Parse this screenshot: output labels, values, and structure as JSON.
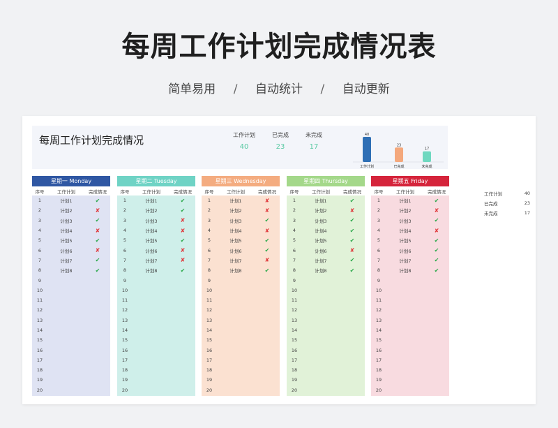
{
  "header": {
    "title": "每周工作计划完成情况表",
    "tags": [
      "简单易用",
      "自动统计",
      "自动更新"
    ],
    "separator": "/"
  },
  "summary": {
    "title": "每周工作计划完成情况",
    "stats": [
      {
        "label": "工作计划",
        "value": "40"
      },
      {
        "label": "已完成",
        "value": "23"
      },
      {
        "label": "未完成",
        "value": "17"
      }
    ]
  },
  "chart_data": {
    "type": "bar",
    "categories": [
      "工作计划",
      "已完成",
      "未完成"
    ],
    "values": [
      40,
      23,
      17
    ],
    "colors": [
      "#2e6fb5",
      "#f4a87c",
      "#6fd8c0"
    ],
    "ylim": [
      0,
      40
    ]
  },
  "columns": {
    "no": "序号",
    "plan": "工作计划",
    "status": "完成情况"
  },
  "status_icons": {
    "done": "✔",
    "not_done": "✘"
  },
  "days": [
    {
      "name": "星期一 Monday",
      "header_color": "#2f57a3",
      "body_color": "#dfe3f3",
      "plans": [
        "计划1",
        "计划2",
        "计划3",
        "计划4",
        "计划5",
        "计划6",
        "计划7",
        "计划8"
      ],
      "status": [
        1,
        0,
        1,
        0,
        1,
        0,
        1,
        1
      ]
    },
    {
      "name": "星期二 Tuesday",
      "header_color": "#6fd3c5",
      "body_color": "#cfefea",
      "plans": [
        "计划1",
        "计划2",
        "计划3",
        "计划4",
        "计划5",
        "计划6",
        "计划7",
        "计划8"
      ],
      "status": [
        1,
        1,
        0,
        0,
        1,
        0,
        0,
        1
      ]
    },
    {
      "name": "星期三 Wednesday",
      "header_color": "#f4ac80",
      "body_color": "#fbe1d1",
      "plans": [
        "计划1",
        "计划2",
        "计划3",
        "计划4",
        "计划5",
        "计划6",
        "计划7",
        "计划8"
      ],
      "status": [
        0,
        0,
        1,
        0,
        1,
        1,
        0,
        1
      ]
    },
    {
      "name": "星期四 Thursday",
      "header_color": "#a4d88a",
      "body_color": "#e1f2d8",
      "plans": [
        "计划1",
        "计划2",
        "计划3",
        "计划4",
        "计划5",
        "计划6",
        "计划7",
        "计划8"
      ],
      "status": [
        1,
        0,
        1,
        1,
        1,
        0,
        1,
        1
      ]
    },
    {
      "name": "星期五 Friday",
      "header_color": "#d5243b",
      "body_color": "#f8dbe0",
      "plans": [
        "计划1",
        "计划2",
        "计划3",
        "计划4",
        "计划5",
        "计划6",
        "计划7",
        "计划8"
      ],
      "status": [
        1,
        0,
        1,
        0,
        1,
        1,
        1,
        1
      ]
    }
  ],
  "row_numbers": [
    "1",
    "2",
    "3",
    "4",
    "5",
    "6",
    "7",
    "8",
    "9",
    "10",
    "11",
    "12",
    "13",
    "14",
    "15",
    "16",
    "17",
    "18",
    "19",
    "20"
  ],
  "side_summary": [
    {
      "label": "工作计划",
      "value": "40"
    },
    {
      "label": "已完成",
      "value": "23"
    },
    {
      "label": "未完成",
      "value": "17"
    }
  ]
}
